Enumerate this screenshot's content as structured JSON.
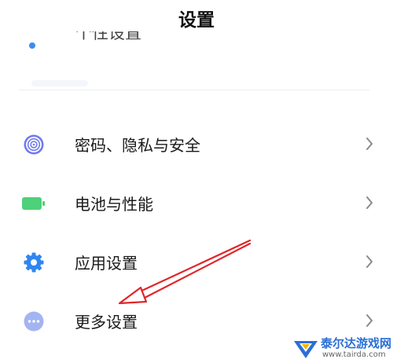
{
  "header": {
    "title": "设置"
  },
  "partial_item": {
    "label": "个性设置"
  },
  "items": [
    {
      "label": "密码、隐私与安全",
      "icon": "fingerprint-icon",
      "color": "#6f7bf0"
    },
    {
      "label": "电池与性能",
      "icon": "battery-icon",
      "color": "#4fd07a"
    },
    {
      "label": "应用设置",
      "icon": "gear-icon",
      "color": "#2f86f0"
    },
    {
      "label": "更多设置",
      "icon": "more-dots-icon",
      "color": "#a3b4f2"
    }
  ],
  "watermark": {
    "name": "泰尔达游戏网",
    "url": "www.tairda.com"
  },
  "colors": {
    "arrow": "#e0262a",
    "chevron": "#8a8a8a",
    "brand": "#2a6fd6"
  }
}
